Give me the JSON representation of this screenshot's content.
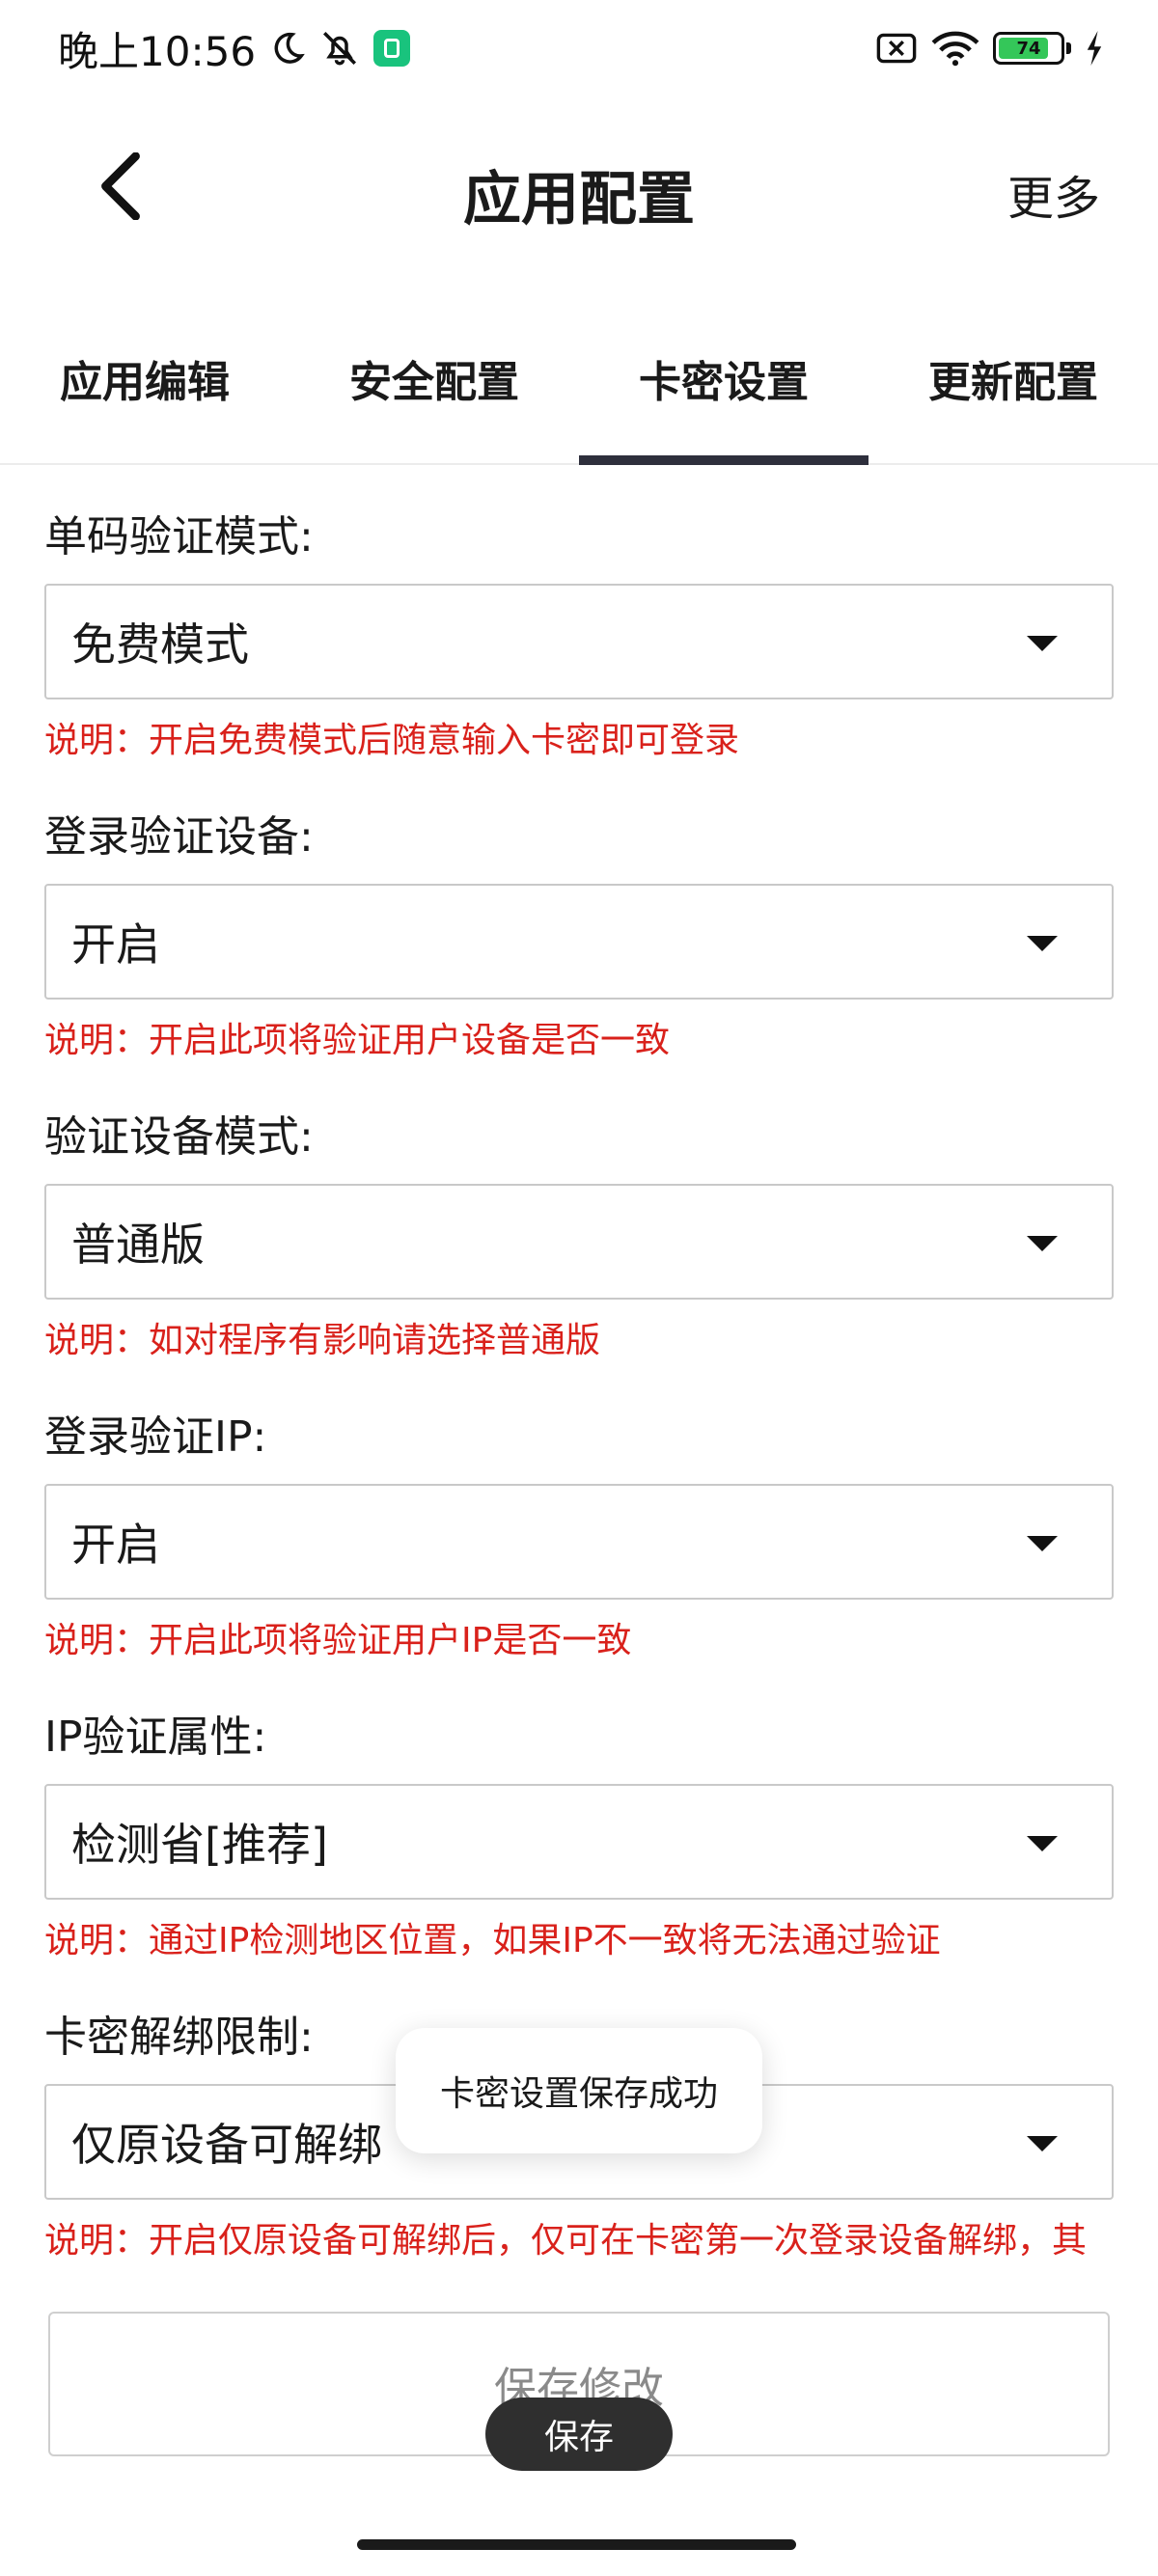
{
  "status_bar": {
    "time": "晚上10:56",
    "battery": "74"
  },
  "header": {
    "title": "应用配置",
    "more_label": "更多"
  },
  "tabs": [
    {
      "label": "应用编辑",
      "active": false
    },
    {
      "label": "安全配置",
      "active": false
    },
    {
      "label": "卡密设置",
      "active": true
    },
    {
      "label": "更新配置",
      "active": false
    }
  ],
  "form": {
    "fields": [
      {
        "label": "单码验证模式:",
        "value": "免费模式",
        "hint": "说明：开启免费模式后随意输入卡密即可登录"
      },
      {
        "label": "登录验证设备:",
        "value": "开启",
        "hint": "说明：开启此项将验证用户设备是否一致"
      },
      {
        "label": "验证设备模式:",
        "value": "普通版",
        "hint": "说明：如对程序有影响请选择普通版"
      },
      {
        "label": "登录验证IP:",
        "value": "开启",
        "hint": "说明：开启此项将验证用户IP是否一致"
      },
      {
        "label": "IP验证属性:",
        "value": "检测省[推荐]",
        "hint": "说明：通过IP检测地区位置，如果IP不一致将无法通过验证"
      },
      {
        "label": "卡密解绑限制:",
        "value": "仅原设备可解绑",
        "hint": "说明：开启仅原设备可解绑后，仅可在卡密第一次登录设备解绑，其"
      }
    ],
    "save_label": "保存修改"
  },
  "toast": {
    "message": "卡密设置保存成功"
  },
  "floating_button": {
    "label": "保存"
  },
  "colors": {
    "hint_red": "#d9211b",
    "tab_indicator": "#2e2f3c",
    "battery_green": "#34c759"
  },
  "icons": [
    "moon-icon",
    "muted-icon",
    "app-notification-icon",
    "sim-icon",
    "wifi-icon",
    "battery-icon",
    "charging-icon",
    "back-arrow-icon",
    "dropdown-caret-icon"
  ]
}
